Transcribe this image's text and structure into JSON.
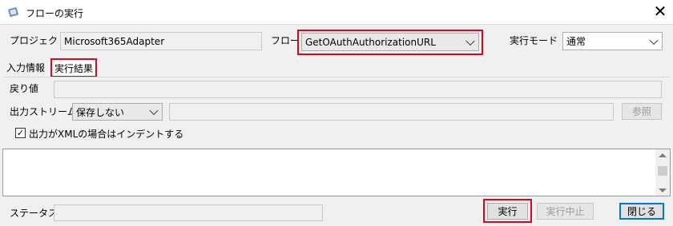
{
  "window": {
    "title": "フローの実行",
    "close_glyph": "✕"
  },
  "header": {
    "project_label": "プロジェクト",
    "project_value": "Microsoft365Adapter",
    "flow_label": "フロー",
    "flow_value": "GetOAuthAuthorizationURL",
    "mode_label": "実行モード",
    "mode_value": "通常"
  },
  "tabs": [
    {
      "label": "入力情報"
    },
    {
      "label": "実行結果"
    }
  ],
  "result": {
    "return_label": "戻り値",
    "return_value": "",
    "stream_label": "出力ストリーム",
    "stream_option": "保存しない",
    "stream_path": "",
    "browse_label": "参照",
    "indent_checked": true,
    "indent_label": "出力がXMLの場合はインデントする",
    "check_glyph": "✓",
    "output_text": ""
  },
  "footer": {
    "status_label": "ステータス",
    "status_value": "",
    "run_label": "実行",
    "stop_label": "実行中止",
    "close_label": "閉じる"
  },
  "colors": {
    "highlight": "#e5001b",
    "window_bg": "#f0f0f0"
  },
  "icons": [
    "app-icon",
    "close-icon",
    "chevron-down-icon",
    "check-icon",
    "scroll-up-icon",
    "scroll-down-icon"
  ]
}
